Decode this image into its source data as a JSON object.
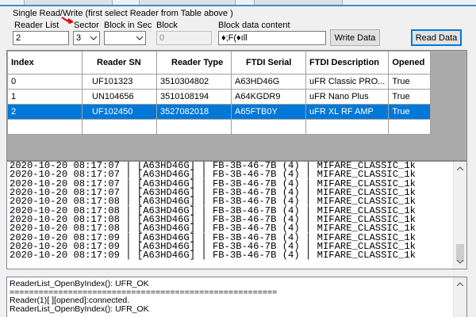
{
  "section": {
    "title": "Single Read/Write  (first select Reader from Table above )"
  },
  "form": {
    "reader_list": {
      "label": "Reader List",
      "value": "2"
    },
    "sector": {
      "label": "Sector",
      "value": "3"
    },
    "block_in_sec": {
      "label": "Block in Sec",
      "value": ""
    },
    "block": {
      "label": "Block",
      "value": "0"
    },
    "block_data": {
      "label": "Block data content",
      "value": "♦;F(♦ıll"
    },
    "write_label": "Write Data",
    "read_label": "Read Data"
  },
  "grid": {
    "columns": [
      "Index",
      "Reader SN",
      "Reader Type",
      "FTDI Serial",
      "FTDI Description",
      "Opened"
    ],
    "rows": [
      [
        "0",
        "UF101323",
        "3510304802",
        "A63HD46G",
        "uFR Classic PRO...",
        "True"
      ],
      [
        "1",
        "UN104656",
        "3510108194",
        "A64KGDR9",
        "uFR Nano Plus",
        "True"
      ],
      [
        "2",
        "UF102450",
        "3527082018",
        "A65FTB0Y",
        "uFR XL RF AMP",
        "True"
      ]
    ],
    "selected_row": 2
  },
  "log": {
    "lines": [
      "2020-10-20 08:17:07 | [A63HD46G] | FB-3B-46-7B (4) | MIFARE_CLASSIC_1k",
      "2020-10-20 08:17:07 | [A63HD46G] | FB-3B-46-7B (4) | MIFARE_CLASSIC_1k",
      "2020-10-20 08:17:07 | [A63HD46G] | FB-3B-46-7B (4) | MIFARE_CLASSIC_1k",
      "2020-10-20 08:17:07 | [A63HD46G] | FB-3B-46-7B (4) | MIFARE_CLASSIC_1k",
      "2020-10-20 08:17:08 | [A63HD46G] | FB-3B-46-7B (4) | MIFARE_CLASSIC_1k",
      "2020-10-20 08:17:08 | [A63HD46G] | FB-3B-46-7B (4) | MIFARE_CLASSIC_1k",
      "2020-10-20 08:17:08 | [A63HD46G] | FB-3B-46-7B (4) | MIFARE_CLASSIC_1k",
      "2020-10-20 08:17:08 | [A63HD46G] | FB-3B-46-7B (4) | MIFARE_CLASSIC_1k",
      "2020-10-20 08:17:09 | [A63HD46G] | FB-3B-46-7B (4) | MIFARE_CLASSIC_1k",
      "2020-10-20 08:17:09 | [A63HD46G] | FB-3B-46-7B (4) | MIFARE_CLASSIC_1k",
      "2020-10-20 08:17:09 | [A63HD46G] | FB-3B-46-7B (4) | MIFARE_CLASSIC_1k"
    ]
  },
  "status": {
    "lines": [
      "ReaderList_OpenByIndex(): UFR_OK",
      "=======================================================",
      "Reader(1)[ ][opened]:connected.",
      "ReaderList_OpenByIndex(): UFR_OK"
    ]
  },
  "icons": {
    "dropdown": "chevron-down-icon",
    "pointer": "red-arrow-pointer-icon"
  },
  "colors": {
    "selection": "#0078d7",
    "default_button_border": "#0078d7"
  }
}
